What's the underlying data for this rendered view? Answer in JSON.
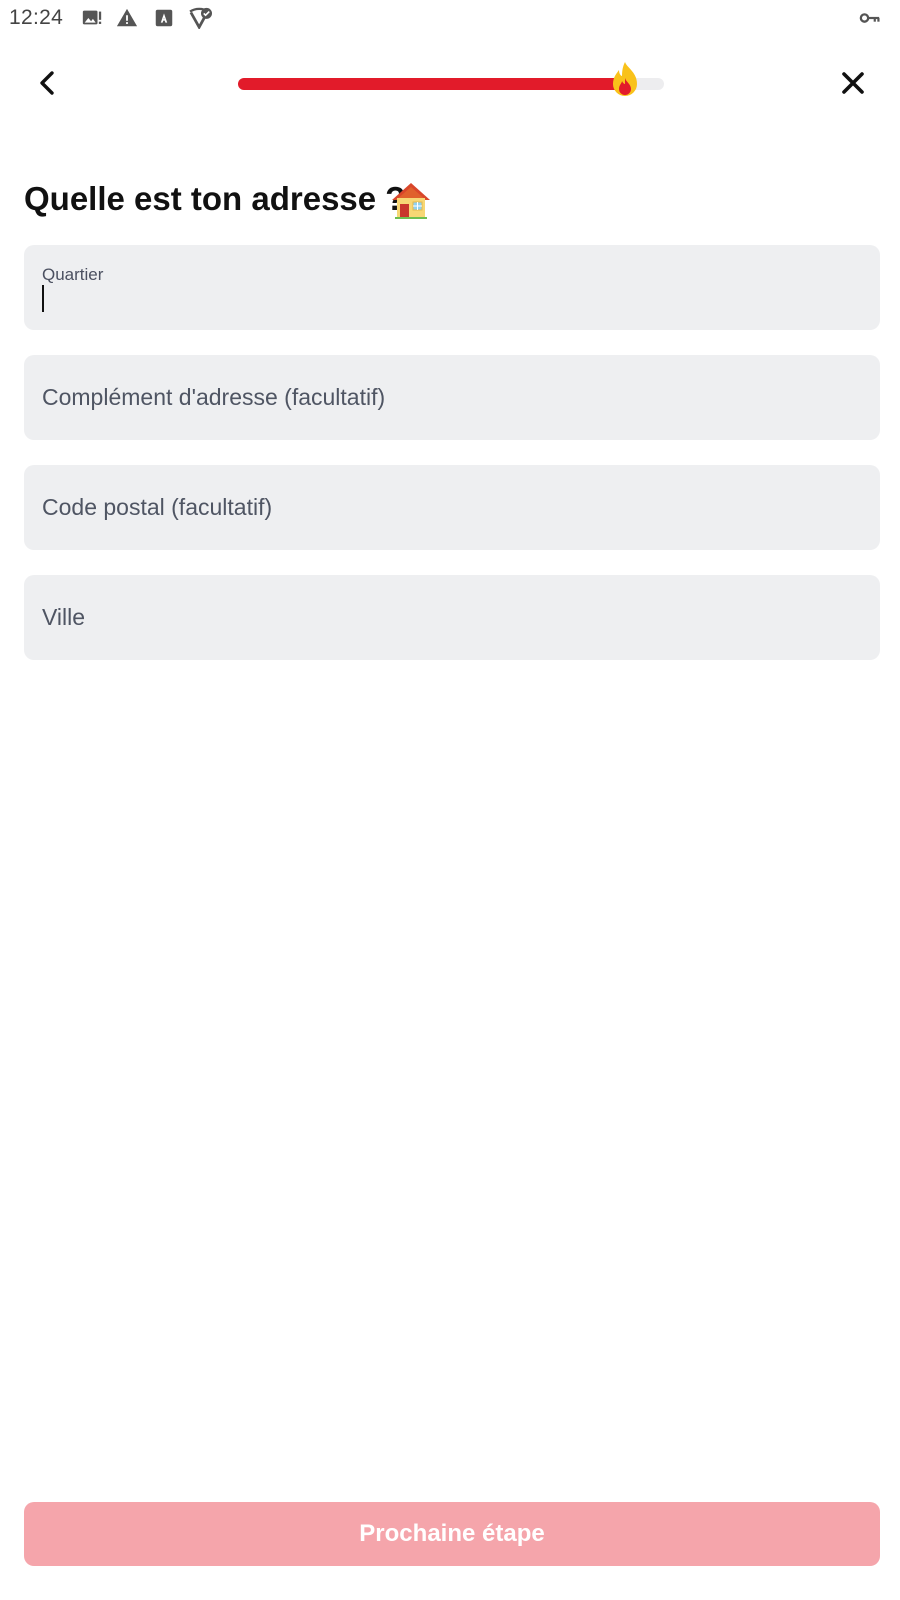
{
  "status_bar": {
    "time": "12:24",
    "icons": [
      "image-alert-icon",
      "warning-icon",
      "font-download-icon",
      "vpn-check-icon",
      "key-icon"
    ]
  },
  "header": {
    "back_icon": "chevron-left-icon",
    "close_icon": "close-icon",
    "progress": {
      "value": 0.9,
      "fill_color": "#e21b2a",
      "track_color": "#ededef",
      "indicator_icon": "flame-icon"
    }
  },
  "main": {
    "title": "Quelle est ton adresse ?",
    "title_icon": "house-icon",
    "fields": [
      {
        "label": "Quartier",
        "value": "",
        "focused": true
      },
      {
        "placeholder": "Complément d'adresse (facultatif)",
        "value": ""
      },
      {
        "placeholder": "Code postal (facultatif)",
        "value": ""
      },
      {
        "placeholder": "Ville",
        "value": ""
      }
    ]
  },
  "footer": {
    "next_label": "Prochaine étape",
    "next_color": "#f5a5ab",
    "next_enabled": false
  }
}
